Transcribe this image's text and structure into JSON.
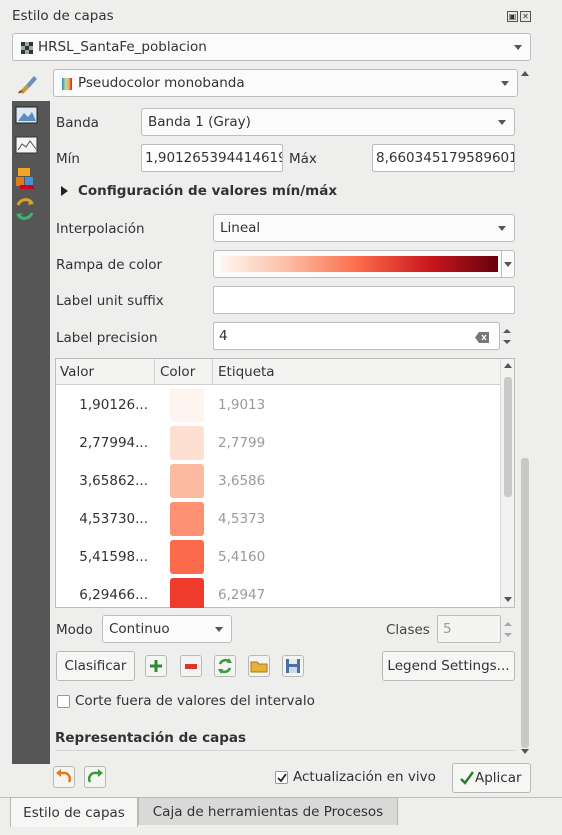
{
  "panel": {
    "title": "Estilo de capas"
  },
  "layer_select": {
    "value": "HRSL_SantaFe_poblacion"
  },
  "renderer_select": {
    "value": "Pseudocolor monobanda"
  },
  "banda": {
    "label": "Banda",
    "value": "Banda 1 (Gray)"
  },
  "min": {
    "label": "Mín",
    "value": "1,901265394414619"
  },
  "max": {
    "label": "Máx",
    "value": "8,660345179589601"
  },
  "minmax_section": {
    "label": "Configuración de valores mín/máx"
  },
  "interpolacion": {
    "label": "Interpolación",
    "value": "Lineal"
  },
  "rampa": {
    "label": "Rampa de color",
    "colors": [
      "#fff5f0",
      "#fcbba1",
      "#fb6a4a",
      "#cb181d",
      "#67000d"
    ]
  },
  "unit_suffix": {
    "label": "Label unit suffix",
    "value": ""
  },
  "precision": {
    "label": "Label precision",
    "value": "4"
  },
  "table": {
    "headers": {
      "valor": "Valor",
      "color": "Color",
      "etiqueta": "Etiqueta"
    },
    "rows": [
      {
        "valor": "1,90126...",
        "color": "#fff5f0",
        "etiqueta": "1,9013"
      },
      {
        "valor": "2,77994...",
        "color": "#fde0d2",
        "etiqueta": "2,7799"
      },
      {
        "valor": "3,65862...",
        "color": "#fcbba1",
        "etiqueta": "3,6586"
      },
      {
        "valor": "4,53730...",
        "color": "#fc9272",
        "etiqueta": "4,5373"
      },
      {
        "valor": "5,41598...",
        "color": "#fb6a4a",
        "etiqueta": "5,4160"
      },
      {
        "valor": "6,29466...",
        "color": "#ef3b2c",
        "etiqueta": "6,2947"
      }
    ]
  },
  "modo": {
    "label": "Modo",
    "value": "Continuo"
  },
  "clases": {
    "label": "Clases",
    "value": "5"
  },
  "buttons": {
    "clasificar": "Clasificar",
    "legend": "Legend Settings..."
  },
  "corte": {
    "label": "Corte fuera de valores del intervalo"
  },
  "representacion": {
    "label": "Representación de capas"
  },
  "live_update": {
    "label": "Actualización en vivo"
  },
  "apply": {
    "label": "Aplicar"
  },
  "tabs": [
    {
      "label": "Estilo de capas"
    },
    {
      "label": "Caja de herramientas de Procesos"
    }
  ]
}
